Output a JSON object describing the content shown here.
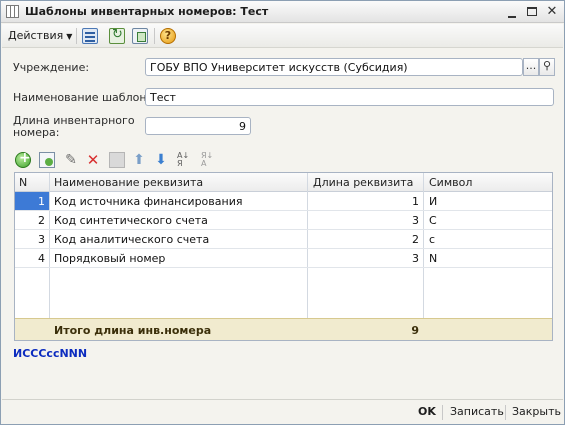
{
  "window": {
    "title": "Шаблоны инвентарных номеров: Тест"
  },
  "toolbar": {
    "actions_label": "Действия",
    "help_label": "?"
  },
  "form": {
    "institution_label": "Учреждение:",
    "institution_value": "ГОБУ ВПО Университет искусств (Субсидия)",
    "institution_picker_label": "...",
    "template_name_label": "Наименование шаблона:",
    "template_name_value": "Тест",
    "length_label_line1": "Длина инвентарного",
    "length_label_line2": "номера:",
    "length_value": "9"
  },
  "table": {
    "columns": [
      "N",
      "Наименование реквизита",
      "Длина реквизита",
      "Символ"
    ],
    "rows": [
      {
        "n": "1",
        "name": "Код источника финансирования",
        "length": "1",
        "symbol": "И"
      },
      {
        "n": "2",
        "name": "Код синтетического счета",
        "length": "3",
        "symbol": "С"
      },
      {
        "n": "3",
        "name": "Код аналитического счета",
        "length": "2",
        "symbol": "с"
      },
      {
        "n": "4",
        "name": "Порядковый номер",
        "length": "3",
        "symbol": "N"
      }
    ],
    "total_label": "Итого длина инв.номера",
    "total_value": "9"
  },
  "formula": "ИСССссNNN",
  "bottom": {
    "ok_label": "OK",
    "save_label": "Записать",
    "close_label": "Закрыть"
  },
  "colors": {
    "selection": "#3d7ad6",
    "formula_text": "#0b2bbf",
    "footer_bg": "#f1ebcf"
  }
}
